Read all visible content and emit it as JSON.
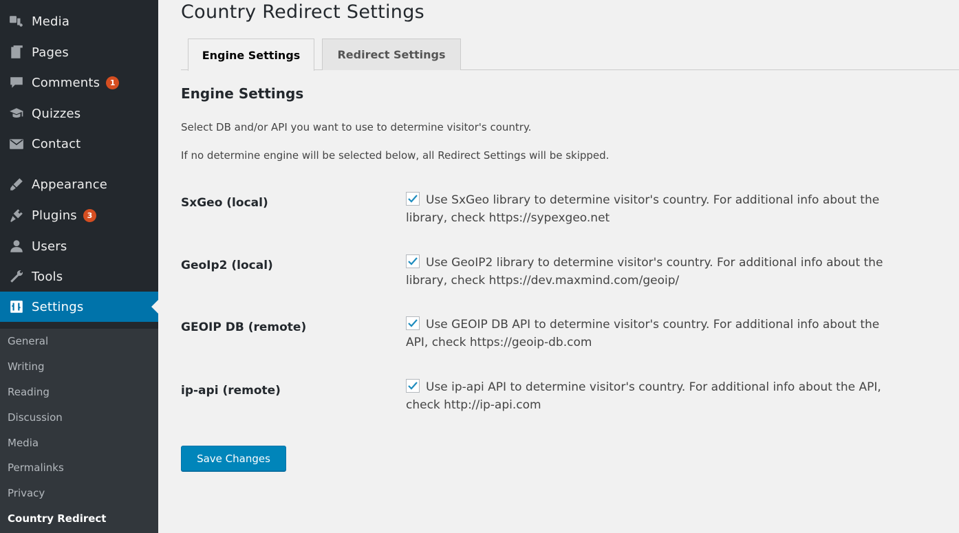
{
  "sidebar": {
    "items": [
      {
        "label": "Media",
        "icon": "media-icon",
        "badge": null
      },
      {
        "label": "Pages",
        "icon": "pages-icon",
        "badge": null
      },
      {
        "label": "Comments",
        "icon": "comments-icon",
        "badge": "1"
      },
      {
        "label": "Quizzes",
        "icon": "quizzes-icon",
        "badge": null
      },
      {
        "label": "Contact",
        "icon": "contact-icon",
        "badge": null
      },
      {
        "label": "Appearance",
        "icon": "appearance-icon",
        "badge": null
      },
      {
        "label": "Plugins",
        "icon": "plugins-icon",
        "badge": "3"
      },
      {
        "label": "Users",
        "icon": "users-icon",
        "badge": null
      },
      {
        "label": "Tools",
        "icon": "tools-icon",
        "badge": null
      },
      {
        "label": "Settings",
        "icon": "settings-icon",
        "badge": null
      }
    ],
    "submenu": [
      "General",
      "Writing",
      "Reading",
      "Discussion",
      "Media",
      "Permalinks",
      "Privacy",
      "Country Redirect"
    ],
    "active_item": "Settings",
    "current_submenu": "Country Redirect"
  },
  "page": {
    "title": "Country Redirect Settings",
    "tabs": [
      {
        "label": "Engine Settings",
        "active": true
      },
      {
        "label": "Redirect Settings",
        "active": false
      }
    ],
    "section_title": "Engine Settings",
    "description_1": "Select DB and/or API you want to use to determine visitor's country.",
    "description_2": "If no determine engine will be selected below, all Redirect Settings will be skipped.",
    "engines": [
      {
        "label": "SxGeo (local)",
        "checked": true,
        "text_line1": "Use SxGeo library to determine visitor's country. For additional info about the",
        "text_line2": "library, check https://sypexgeo.net"
      },
      {
        "label": "GeoIp2 (local)",
        "checked": true,
        "text_line1": "Use GeoIP2 library to determine visitor's country. For additional info about the",
        "text_line2": "library, check https://dev.maxmind.com/geoip/"
      },
      {
        "label": "GEOIP DB (remote)",
        "checked": true,
        "text_line1": "Use GEOIP DB API to determine visitor's country. For additional info about the",
        "text_line2": "API, check https://geoip-db.com"
      },
      {
        "label": "ip-api (remote)",
        "checked": true,
        "text_line1": "Use ip-api API to determine visitor's country. For additional info about the API,",
        "text_line2": "check http://ip-api.com"
      }
    ],
    "save_label": "Save Changes"
  },
  "colors": {
    "sidebar_bg": "#23282d",
    "submenu_bg": "#32373c",
    "active_bg": "#0073aa",
    "badge_bg": "#d54e21",
    "button_bg": "#0085ba",
    "check_color": "#1e8cbe"
  }
}
